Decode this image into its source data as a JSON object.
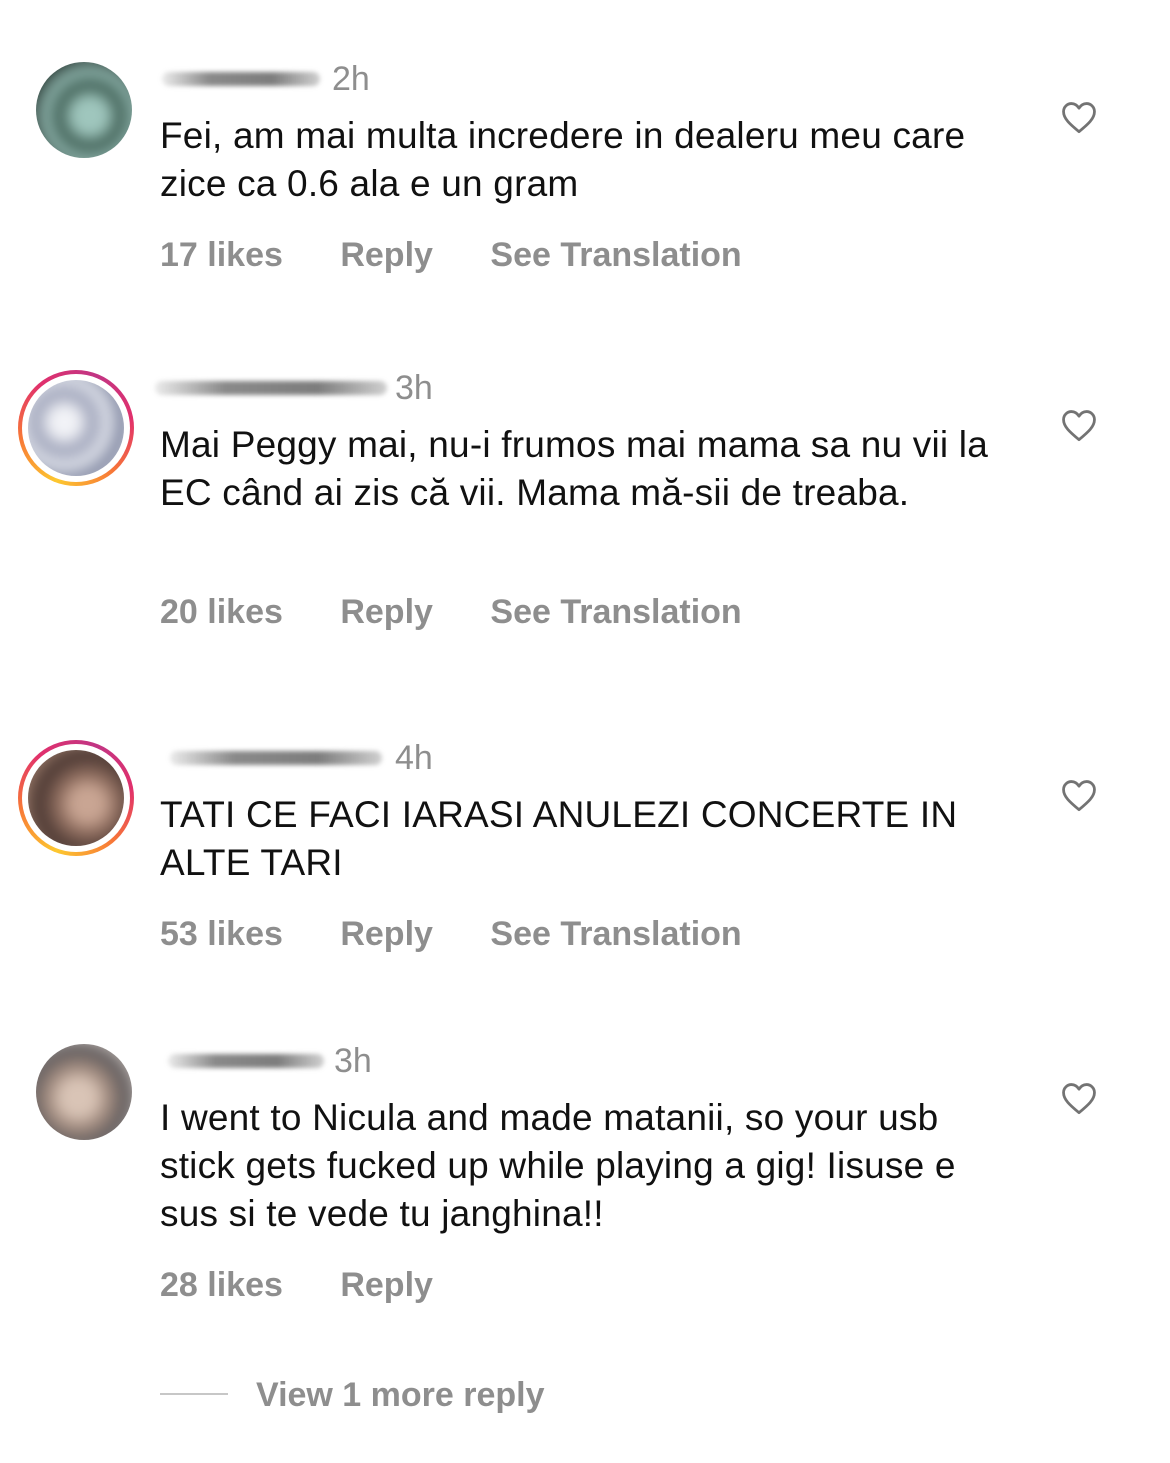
{
  "comments": [
    {
      "time": "2h",
      "text": "Fei, am mai multa incredere in dealeru meu care zice ca 0.6 ala e un gram",
      "likes": "17 likes",
      "reply": "Reply",
      "translation": "See Translation",
      "avatar_colors": [
        "#2f4a3e",
        "#8fb5ad",
        "#1d2b26"
      ],
      "story_ring": false
    },
    {
      "time": "3h",
      "text": "Mai Peggy mai, nu-i frumos mai mama sa nu vii la EC când ai zis că vii. Mama mă-sii de treaba.",
      "likes": "20 likes",
      "reply": "Reply",
      "translation": "See Translation",
      "avatar_colors": [
        "#c9cbd6",
        "#8a8fa6",
        "#eef0f4"
      ],
      "story_ring": true
    },
    {
      "time": "4h",
      "text": "TATI CE FACI IARASI ANULEZI CONCERTE IN ALTE TARI",
      "likes": "53 likes",
      "reply": "Reply",
      "translation": "See Translation",
      "avatar_colors": [
        "#6b4e44",
        "#b08a78",
        "#3e2e2a"
      ],
      "story_ring": true
    },
    {
      "time": "3h",
      "text": "I went to Nicula and made matanii, so your usb stick gets fucked up while playing a gig! Iisuse e sus si te vede tu janghina!!",
      "likes": "28 likes",
      "reply": "Reply",
      "translation": "",
      "avatar_colors": [
        "#8a7a70",
        "#c8b4a6",
        "#4d4a4a"
      ],
      "story_ring": false
    }
  ],
  "view_more_replies": "View 1 more reply",
  "icons": {
    "like": "heart-outline-icon"
  },
  "colors": {
    "secondary_text": "#8e8e8e",
    "primary_text": "#111111",
    "story_ring_gradient": [
      "#fdc830",
      "#f77737",
      "#e1306c",
      "#c13584"
    ]
  }
}
